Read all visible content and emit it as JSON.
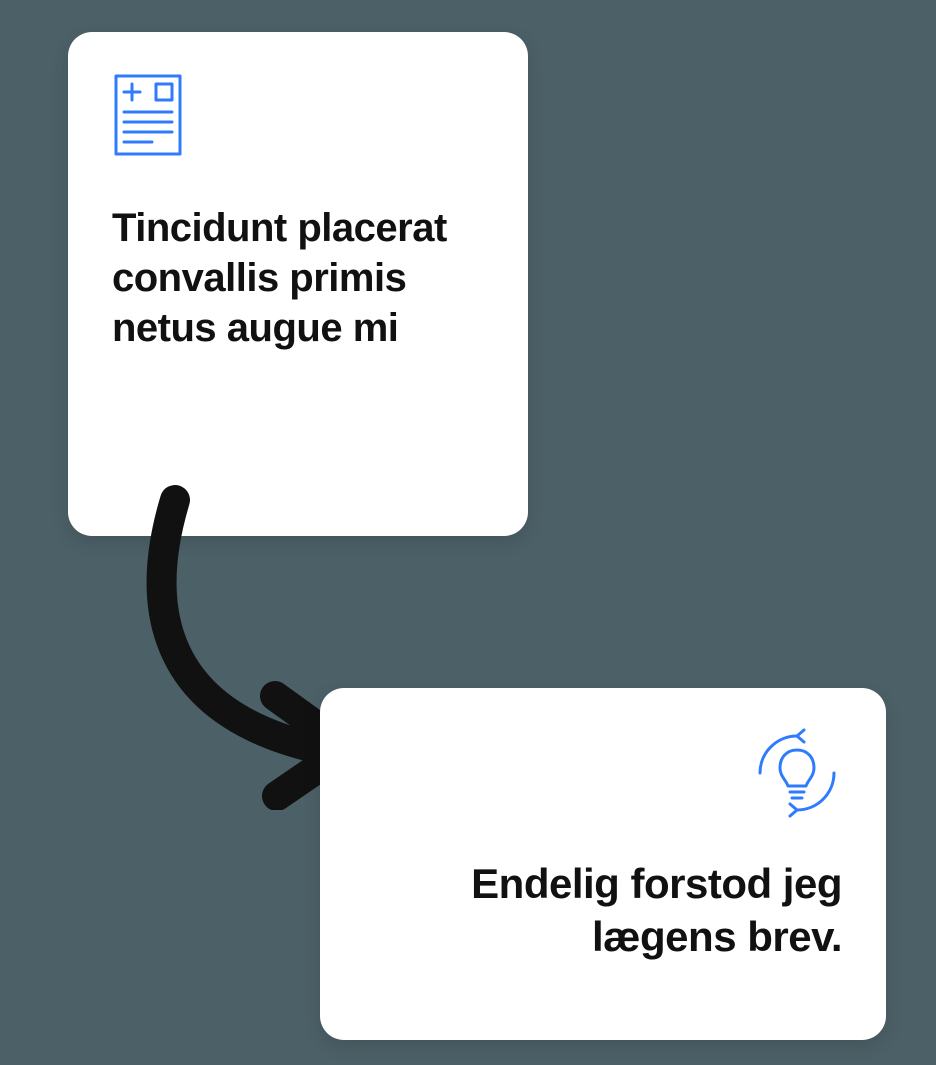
{
  "colors": {
    "accent": "#2f7bff",
    "text": "#111111",
    "background": "#4c6067",
    "card": "#ffffff"
  },
  "top_card": {
    "icon": "medical-document-icon",
    "title": "Tincidunt placerat convallis primis netus augue mi"
  },
  "bottom_card": {
    "icon": "lightbulb-refresh-icon",
    "title": "Endelig forstod jeg lægens brev."
  }
}
